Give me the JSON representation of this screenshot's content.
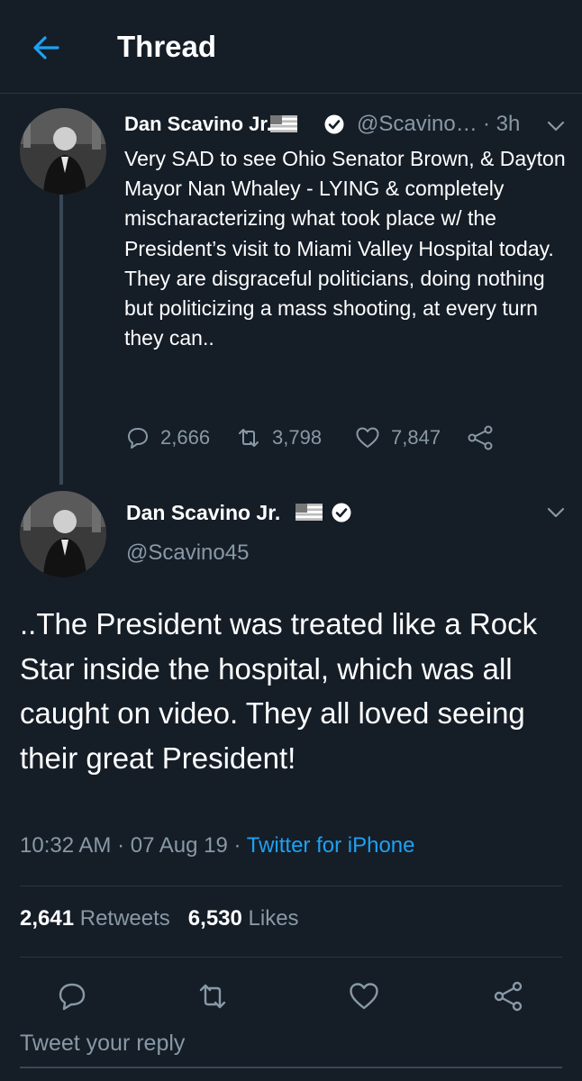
{
  "header": {
    "title": "Thread",
    "back_icon": "arrow-left-icon"
  },
  "colors": {
    "background": "#151d27",
    "accent": "#1da1f2",
    "muted": "#8899a6",
    "text": "#ffffff"
  },
  "tweet1": {
    "name": "Dan Scavino Jr.",
    "handle": "@Scavino…",
    "time": "· 3h",
    "text": "Very SAD to see Ohio Senator Brown, & Dayton Mayor Nan Whaley - LYING & completely mischaracterizing what took place w/ the President’s visit to Miami Valley Hospital today. They are disgraceful politicians, doing nothing but politicizing a mass shooting, at every turn they can..",
    "replies": "2,666",
    "retweets": "3,798",
    "likes": "7,847"
  },
  "tweet2": {
    "name": "Dan Scavino Jr.",
    "handle": "@Scavino45",
    "text": "..The President was treated like a Rock Star inside the hospital, which was all caught on video. They all loved seeing their great President!",
    "time": "10:32 AM · 07 Aug 19 ·",
    "source": "Twitter for iPhone",
    "retweet_count": "2,641",
    "retweet_label": "Retweets",
    "like_count": "6,530",
    "like_label": "Likes"
  },
  "reply": {
    "placeholder": "Tweet your reply"
  }
}
